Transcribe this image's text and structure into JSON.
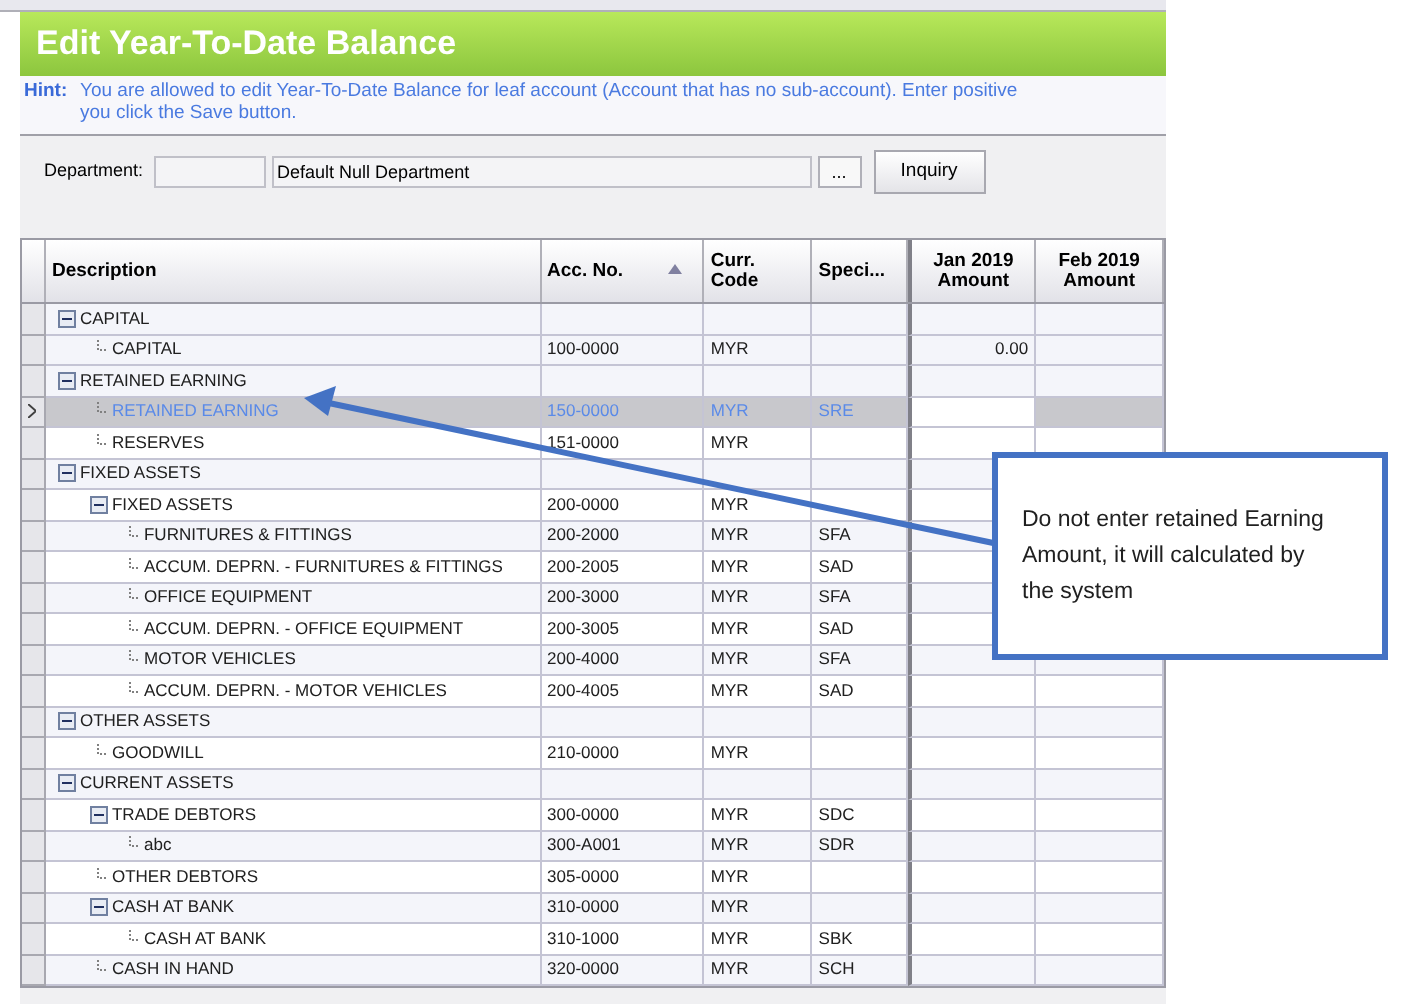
{
  "window": {
    "title": "Edit Year-To-Date Balance"
  },
  "hint": {
    "label": "Hint:",
    "text": "You are allowed to edit Year-To-Date Balance for leaf account (Account that has no sub-account). Enter positive",
    "text_line_2": "you click the Save button."
  },
  "department": {
    "label": "Department:",
    "name": "Default Null Department",
    "browse": "...",
    "inquiry": "Inquiry"
  },
  "table": {
    "columns": [
      {
        "label": "Description",
        "sorted": false
      },
      {
        "label": "Acc. No.",
        "sorted": true
      },
      {
        "label": "Curr. Code",
        "sorted": false
      },
      {
        "label": "Speci...",
        "sorted": false
      },
      {
        "label": "Jan 2019 Amount",
        "sorted": false
      },
      {
        "label": "Feb 2019 Amount",
        "sorted": false
      }
    ],
    "rows": [
      {
        "description": "CAPITAL",
        "selected": false,
        "expanded": true,
        "children": [
          {
            "description": "CAPITAL",
            "acc_no": "100-0000",
            "curr_code": "MYR",
            "jan": "0.00",
            "selected": false
          }
        ]
      },
      {
        "description": "RETAINED EARNING",
        "selected": false,
        "expanded": true,
        "children": [
          {
            "description": "RETAINED EARNING",
            "acc_no": "150-0000",
            "curr_code": "MYR",
            "special": "SRE",
            "selected": true
          },
          {
            "description": "RESERVES",
            "acc_no": "151-0000",
            "curr_code": "MYR",
            "selected": false
          }
        ]
      },
      {
        "description": "FIXED ASSETS",
        "selected": false,
        "expanded": true,
        "children": [
          {
            "description": "FIXED ASSETS",
            "acc_no": "200-0000",
            "curr_code": "MYR",
            "selected": false,
            "expanded": true,
            "children": [
              {
                "description": "FURNITURES & FITTINGS",
                "acc_no": "200-2000",
                "curr_code": "MYR",
                "special": "SFA",
                "selected": false
              },
              {
                "description": "ACCUM. DEPRN. - FURNITURES & FITTINGS",
                "acc_no": "200-2005",
                "curr_code": "MYR",
                "special": "SAD",
                "selected": false
              },
              {
                "description": "OFFICE EQUIPMENT",
                "acc_no": "200-3000",
                "curr_code": "MYR",
                "special": "SFA",
                "selected": false
              },
              {
                "description": "ACCUM. DEPRN. - OFFICE EQUIPMENT",
                "acc_no": "200-3005",
                "curr_code": "MYR",
                "special": "SAD",
                "selected": false
              },
              {
                "description": "MOTOR VEHICLES",
                "acc_no": "200-4000",
                "curr_code": "MYR",
                "special": "SFA",
                "selected": false
              },
              {
                "description": "ACCUM. DEPRN. - MOTOR VEHICLES",
                "acc_no": "200-4005",
                "curr_code": "MYR",
                "special": "SAD",
                "selected": false
              }
            ]
          }
        ]
      },
      {
        "description": "OTHER ASSETS",
        "selected": false,
        "expanded": true,
        "children": [
          {
            "description": "GOODWILL",
            "acc_no": "210-0000",
            "curr_code": "MYR",
            "selected": false
          }
        ]
      },
      {
        "description": "CURRENT ASSETS",
        "selected": false,
        "expanded": true,
        "children": [
          {
            "description": "TRADE DEBTORS",
            "acc_no": "300-0000",
            "curr_code": "MYR",
            "special": "SDC",
            "selected": false,
            "expanded": true,
            "children": [
              {
                "description": "abc",
                "acc_no": "300-A001",
                "curr_code": "MYR",
                "special": "SDR",
                "selected": false
              }
            ]
          },
          {
            "description": "OTHER DEBTORS",
            "acc_no": "305-0000",
            "curr_code": "MYR",
            "selected": false
          },
          {
            "description": "CASH AT BANK",
            "acc_no": "310-0000",
            "curr_code": "MYR",
            "selected": false,
            "expanded": true,
            "children": [
              {
                "description": "CASH AT BANK",
                "acc_no": "310-1000",
                "curr_code": "MYR",
                "special": "SBK",
                "selected": false
              }
            ]
          },
          {
            "description": "CASH IN HAND",
            "acc_no": "320-0000",
            "curr_code": "MYR",
            "special": "SCH",
            "selected": false
          }
        ]
      }
    ]
  },
  "callout": {
    "text": "Do not enter retained Earning Amount, it will calculated by the system"
  }
}
